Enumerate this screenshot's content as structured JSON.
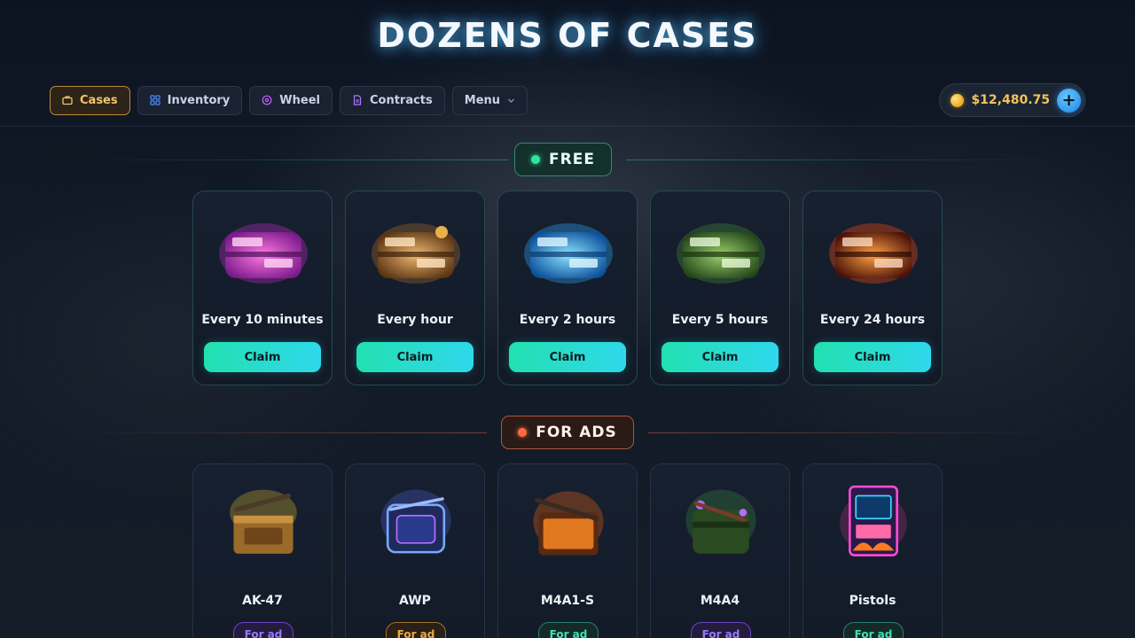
{
  "hero": {
    "title": "DOZENS OF CASES"
  },
  "nav": {
    "items": [
      {
        "label": "Cases",
        "icon": "case-icon",
        "active": true
      },
      {
        "label": "Inventory",
        "icon": "grid-icon"
      },
      {
        "label": "Wheel",
        "icon": "wheel-icon"
      },
      {
        "label": "Contracts",
        "icon": "document-icon"
      },
      {
        "label": "Menu",
        "icon": "chevron-down-icon"
      }
    ]
  },
  "balance": {
    "amount": "$12,480.75",
    "add_label": "+"
  },
  "sections": {
    "free": {
      "label": "FREE",
      "accent": "#2ee59a"
    },
    "ads": {
      "label": "FOR ADS",
      "accent": "#ff6a3d"
    }
  },
  "free_cases": [
    {
      "title": "Every 10 minutes",
      "button": "Claim",
      "theme": "pink"
    },
    {
      "title": "Every hour",
      "button": "Claim",
      "theme": "bronze"
    },
    {
      "title": "Every 2 hours",
      "button": "Claim",
      "theme": "ice"
    },
    {
      "title": "Every 5 hours",
      "button": "Claim",
      "theme": "jungle"
    },
    {
      "title": "Every 24 hours",
      "button": "Claim",
      "theme": "lava"
    }
  ],
  "ad_cases": [
    {
      "title": "AK-47",
      "badge": "For ad",
      "badge_color": "purple"
    },
    {
      "title": "AWP",
      "badge": "For ad",
      "badge_color": "orange"
    },
    {
      "title": "M4A1-S",
      "badge": "For ad",
      "badge_color": "teal"
    },
    {
      "title": "M4A4",
      "badge": "For ad",
      "badge_color": "purple"
    },
    {
      "title": "Pistols",
      "badge": "For ad",
      "badge_color": "teal"
    }
  ]
}
